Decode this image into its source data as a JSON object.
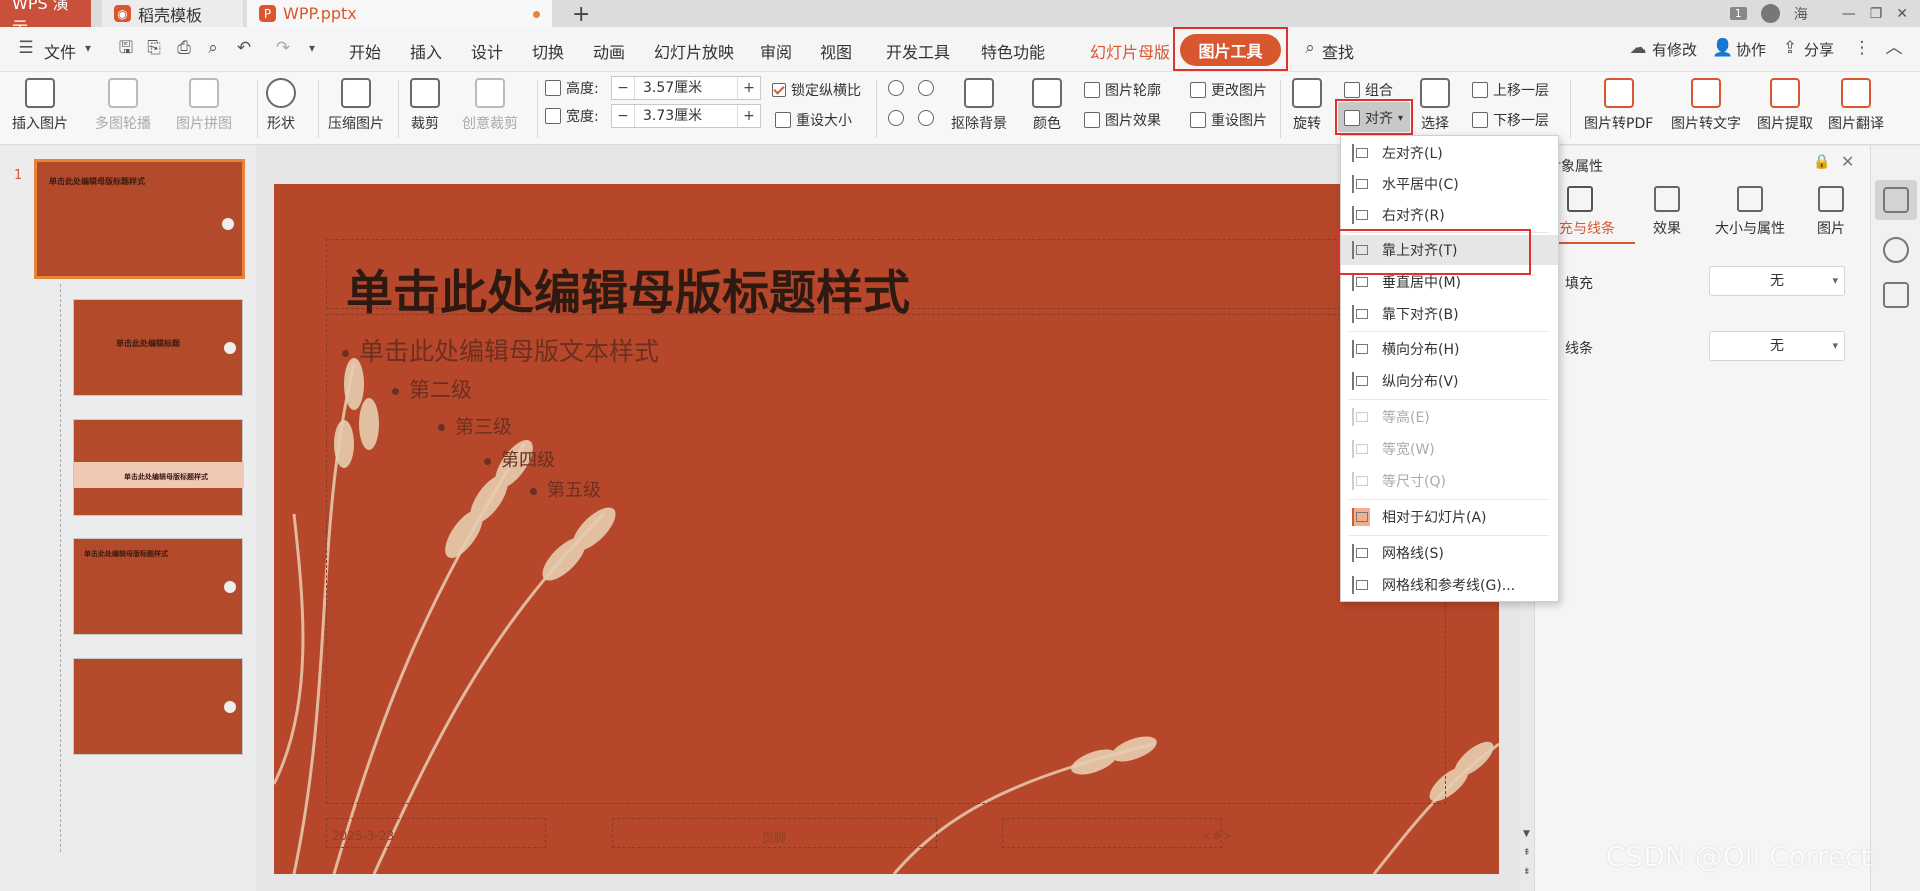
{
  "titlebar": {
    "app_tab": "WPS 演示",
    "template_tab": "稻壳模板",
    "file_tab": "WPP.pptx",
    "new_tab": "+",
    "window_count": "1",
    "user": "海"
  },
  "menu": {
    "file": "文件",
    "items": [
      "开始",
      "插入",
      "设计",
      "切换",
      "动画",
      "幻灯片放映",
      "审阅",
      "视图",
      "开发工具",
      "特色功能"
    ],
    "master": "幻灯片母版",
    "picture_tools": "图片工具",
    "search": "查找",
    "has_changes": "有修改",
    "collab": "协作",
    "share": "分享"
  },
  "ribbon": {
    "insert_picture": "插入图片",
    "multi_carousel": "多图轮播",
    "picture_collage": "图片拼图",
    "shape": "形状",
    "compress": "压缩图片",
    "crop": "裁剪",
    "creative_crop": "创意裁剪",
    "height_label": "高度:",
    "height_value": "3.57厘米",
    "width_label": "宽度:",
    "width_value": "3.73厘米",
    "lock_ratio": "锁定纵横比",
    "reset_size": "重设大小",
    "remove_bg": "抠除背景",
    "color": "颜色",
    "picture_outline": "图片轮廓",
    "picture_effect": "图片效果",
    "change_picture": "更改图片",
    "reset_picture": "重设图片",
    "rotate": "旋转",
    "group": "组合",
    "align": "对齐",
    "select": "选择",
    "bring_forward": "上移一层",
    "send_backward": "下移一层",
    "to_pdf": "图片转PDF",
    "to_text": "图片转文字",
    "extract": "图片提取",
    "translate": "图片翻译"
  },
  "slides_panel": {
    "current_slide_number": "1",
    "thumb_titles": [
      "单击此处编辑母版标题样式",
      "单击此处编辑标题",
      "单击此处编辑母版标题样式",
      "单击此处编辑母版标题样式",
      ""
    ]
  },
  "slide": {
    "title": "单击此处编辑母版标题样式",
    "level1": "单击此处编辑母版文本样式",
    "level2": "第二级",
    "level3": "第三级",
    "level4": "第四级",
    "level5": "第五级",
    "footer_date": "2025-3-23",
    "footer_center": "页脚",
    "footer_page": "<#>"
  },
  "properties": {
    "title": "对象属性",
    "tabs": [
      "填充与线条",
      "效果",
      "大小与属性",
      "图片"
    ],
    "fill_label": "填充",
    "fill_value": "无",
    "line_label": "线条",
    "line_value": "无"
  },
  "align_menu": {
    "items": [
      {
        "label": "左对齐(L)",
        "enabled": true
      },
      {
        "label": "水平居中(C)",
        "enabled": true
      },
      {
        "label": "右对齐(R)",
        "enabled": true
      },
      {
        "label": "靠上对齐(T)",
        "enabled": true,
        "highlighted": true
      },
      {
        "label": "垂直居中(M)",
        "enabled": true
      },
      {
        "label": "靠下对齐(B)",
        "enabled": true
      },
      {
        "label": "横向分布(H)",
        "enabled": true
      },
      {
        "label": "纵向分布(V)",
        "enabled": true
      },
      {
        "label": "等高(E)",
        "enabled": false
      },
      {
        "label": "等宽(W)",
        "enabled": false
      },
      {
        "label": "等尺寸(Q)",
        "enabled": false
      },
      {
        "label": "相对于幻灯片(A)",
        "enabled": true,
        "checked": true
      },
      {
        "label": "网格线(S)",
        "enabled": true
      },
      {
        "label": "网格线和参考线(G)...",
        "enabled": true
      }
    ]
  },
  "watermark": "CSDN @Oll Correct",
  "colors": {
    "accent": "#d9572e",
    "slide_bg": "#b6472a",
    "highlight_frame": "#e03030"
  }
}
